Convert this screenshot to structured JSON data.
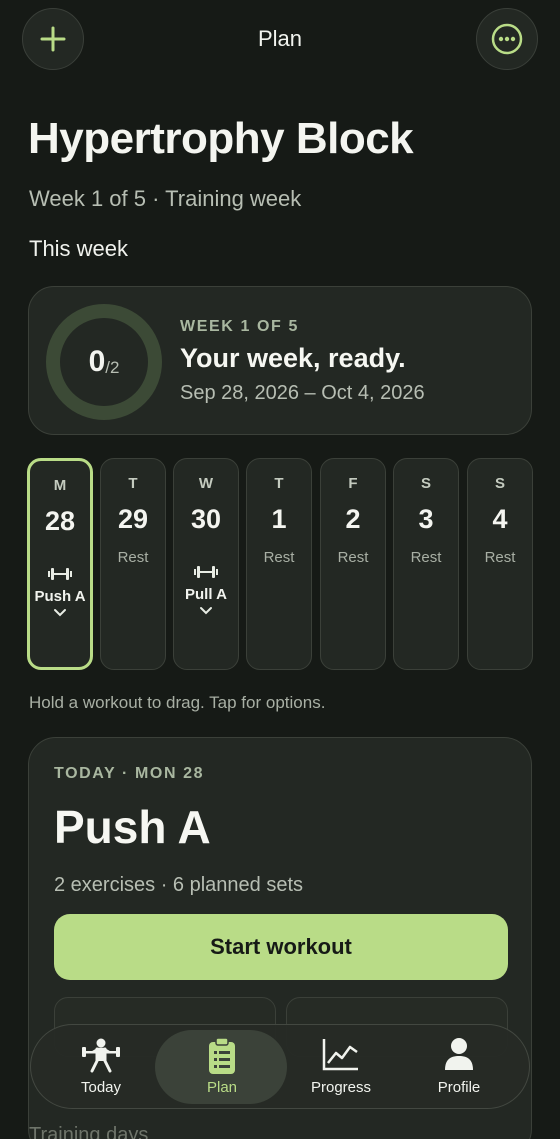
{
  "header": {
    "title": "Plan",
    "add_icon": "plus-icon",
    "more_icon": "ellipsis-icon",
    "accent": "#b9dc87"
  },
  "plan": {
    "name": "Hypertrophy Block",
    "subtitle": "Week 1 of 5 · Training week",
    "section_label": "This week"
  },
  "week_summary": {
    "completed": "0",
    "total": "/2",
    "progress_fraction": 0,
    "eyebrow": "WEEK 1 OF 5",
    "headline": "Your week, ready.",
    "date_range": "Sep 28, 2026 – Oct 4, 2026"
  },
  "days": [
    {
      "letter": "M",
      "num": "28",
      "rest": "",
      "workout": "Push A",
      "selected": true
    },
    {
      "letter": "T",
      "num": "29",
      "rest": "Rest",
      "workout": "",
      "selected": false
    },
    {
      "letter": "W",
      "num": "30",
      "rest": "",
      "workout": "Pull A",
      "selected": false
    },
    {
      "letter": "T",
      "num": "1",
      "rest": "Rest",
      "workout": "",
      "selected": false
    },
    {
      "letter": "F",
      "num": "2",
      "rest": "Rest",
      "workout": "",
      "selected": false
    },
    {
      "letter": "S",
      "num": "3",
      "rest": "Rest",
      "workout": "",
      "selected": false
    },
    {
      "letter": "S",
      "num": "4",
      "rest": "Rest",
      "workout": "",
      "selected": false
    }
  ],
  "hint": "Hold a workout to drag. Tap for options.",
  "today": {
    "eyebrow": "TODAY · MON 28",
    "workout": "Push A",
    "meta": "2 exercises · 6 planned sets",
    "start_label": "Start workout"
  },
  "training_days_label": "Training days",
  "tabs": [
    {
      "label": "Today",
      "icon": "weightlifter-icon",
      "active": false
    },
    {
      "label": "Plan",
      "icon": "clipboard-icon",
      "active": true
    },
    {
      "label": "Progress",
      "icon": "chart-icon",
      "active": false
    },
    {
      "label": "Profile",
      "icon": "person-icon",
      "active": false
    }
  ]
}
